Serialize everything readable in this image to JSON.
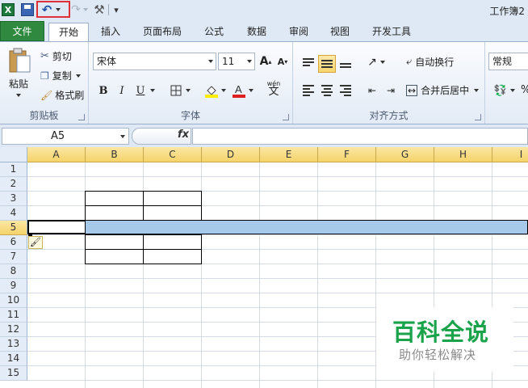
{
  "window": {
    "title": "工作簿2"
  },
  "quick_access": {
    "app_icon": "excel-icon",
    "save_icon": "save-icon",
    "undo_icon": "undo-icon",
    "redo_icon": "redo-icon",
    "tool_icon": "tools-icon",
    "more_glyph": "▾"
  },
  "tabs": [
    {
      "label": "文件"
    },
    {
      "label": "开始"
    },
    {
      "label": "插入"
    },
    {
      "label": "页面布局"
    },
    {
      "label": "公式"
    },
    {
      "label": "数据"
    },
    {
      "label": "审阅"
    },
    {
      "label": "视图"
    },
    {
      "label": "开发工具"
    }
  ],
  "ribbon": {
    "clipboard": {
      "label": "剪贴板",
      "paste": "粘贴",
      "cut": "剪切",
      "copy": "复制",
      "format_painter": "格式刷"
    },
    "font": {
      "label": "字体",
      "font_name": "宋体",
      "font_size": "11",
      "grow": "A",
      "shrink": "A",
      "bold": "B",
      "italic": "I",
      "underline": "U",
      "wen": "wén",
      "wen_char": "文"
    },
    "alignment": {
      "label": "对齐方式",
      "wrap_text": "自动换行",
      "merge_center": "合并后居中"
    },
    "number": {
      "format": "常规"
    }
  },
  "formula_bar": {
    "name_box": "A5",
    "fx": "fx",
    "value": ""
  },
  "grid": {
    "columns": [
      "A",
      "B",
      "C",
      "D",
      "E",
      "F",
      "G",
      "H",
      "I"
    ],
    "rows": [
      "1",
      "2",
      "3",
      "4",
      "5",
      "6",
      "7",
      "8",
      "9",
      "10",
      "11",
      "12",
      "13",
      "14",
      "15"
    ],
    "selected_row": "5"
  },
  "watermark": {
    "title": "百科全说",
    "subtitle": "助你轻松解决"
  },
  "colors": {
    "file_tab": "#2f8a3f",
    "selection": "#a6c9ea",
    "header_active": "#f5d36b",
    "highlight_box": "#e0313b",
    "watermark_green": "#1aa34a"
  }
}
